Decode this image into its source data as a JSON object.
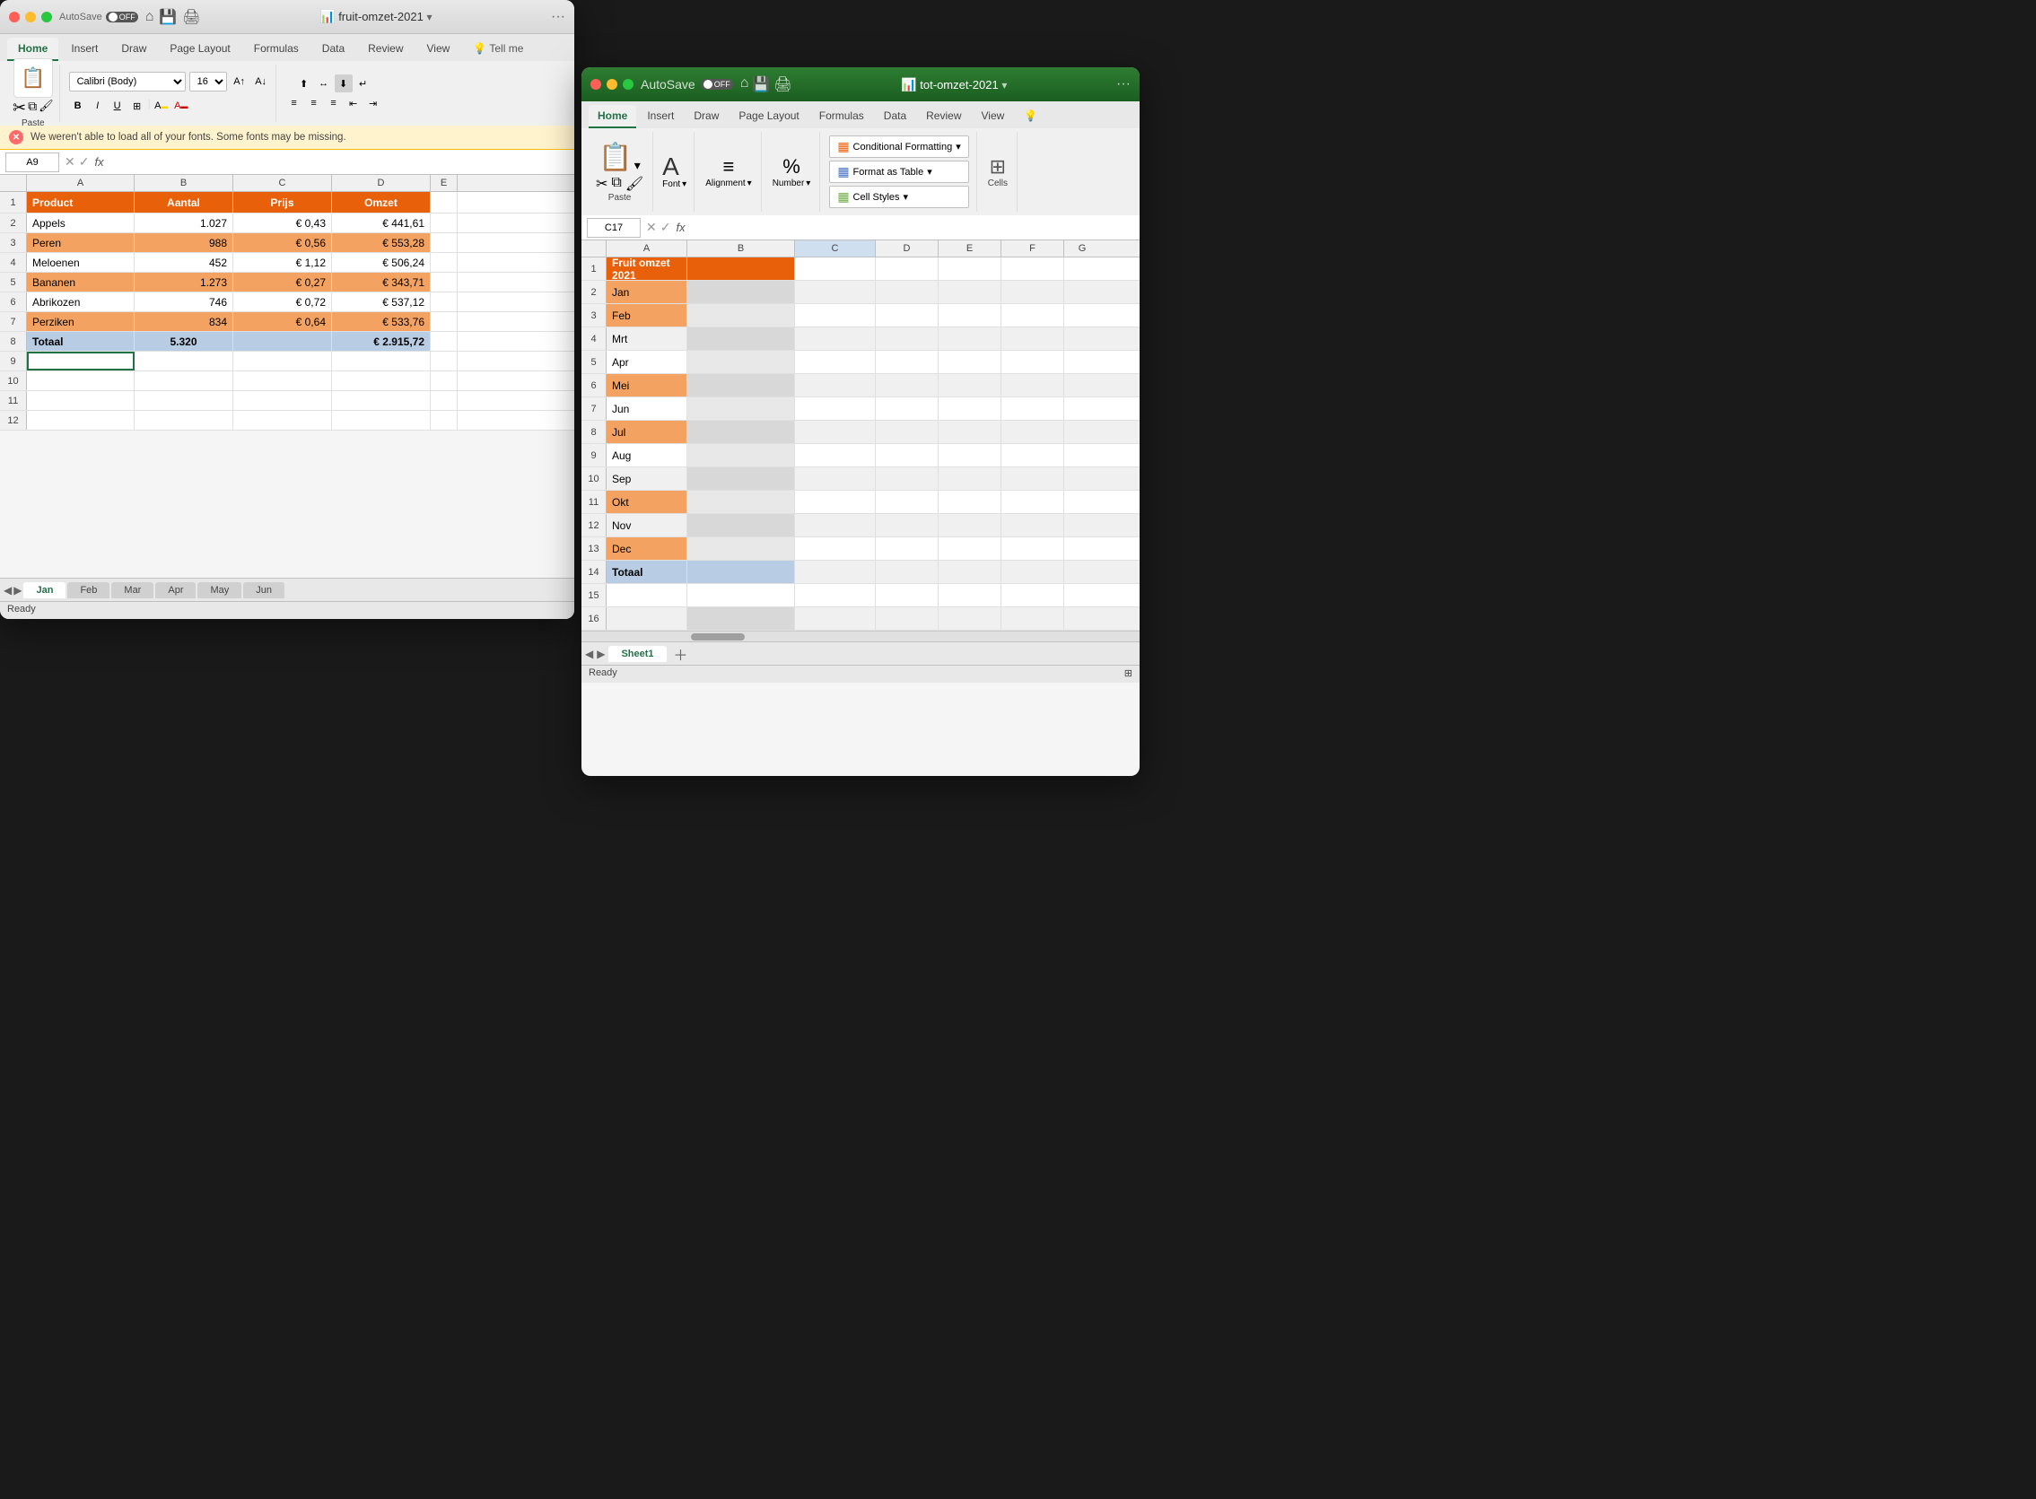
{
  "window1": {
    "title": "fruit-omzet-2021",
    "autosave": "AutoSave",
    "autosave_state": "OFF",
    "tabs": [
      "Home",
      "Insert",
      "Draw",
      "Page Layout",
      "Formulas",
      "Data",
      "Review",
      "View",
      "Tell me"
    ],
    "active_tab": "Home",
    "font_name": "Calibri (Body)",
    "font_size": "16",
    "cell_ref": "A9",
    "formula_text": "",
    "warning_text": "We weren't able to load all of your fonts.  Some fonts may be missing.",
    "columns": [
      {
        "label": "A",
        "width": 120
      },
      {
        "label": "B",
        "width": 110
      },
      {
        "label": "C",
        "width": 110
      },
      {
        "label": "D",
        "width": 110
      },
      {
        "label": "E",
        "width": 30
      }
    ],
    "rows": [
      {
        "num": 1,
        "cells": [
          {
            "text": "Product",
            "bg": "#e8600a",
            "color": "white",
            "bold": true,
            "align": "left"
          },
          {
            "text": "Aantal",
            "bg": "#e8600a",
            "color": "white",
            "bold": true,
            "align": "center"
          },
          {
            "text": "Prijs",
            "bg": "#e8600a",
            "color": "white",
            "bold": true,
            "align": "center"
          },
          {
            "text": "Omzet",
            "bg": "#e8600a",
            "color": "white",
            "bold": true,
            "align": "center"
          },
          {
            "text": "",
            "bg": "",
            "color": "",
            "bold": false,
            "align": "left"
          }
        ]
      },
      {
        "num": 2,
        "cells": [
          {
            "text": "Appels",
            "bg": "",
            "color": "#333",
            "bold": false,
            "align": "left"
          },
          {
            "text": "1.027",
            "bg": "",
            "color": "#333",
            "bold": false,
            "align": "right"
          },
          {
            "text": "€ 0,43",
            "bg": "",
            "color": "#333",
            "bold": false,
            "align": "right"
          },
          {
            "text": "€ 441,61",
            "bg": "",
            "color": "#333",
            "bold": false,
            "align": "right"
          },
          {
            "text": "",
            "bg": "",
            "color": "",
            "bold": false,
            "align": "left"
          }
        ]
      },
      {
        "num": 3,
        "cells": [
          {
            "text": "Peren",
            "bg": "#f4a261",
            "color": "#333",
            "bold": false,
            "align": "left"
          },
          {
            "text": "988",
            "bg": "#f4a261",
            "color": "#333",
            "bold": false,
            "align": "right"
          },
          {
            "text": "€ 0,56",
            "bg": "#f4a261",
            "color": "#333",
            "bold": false,
            "align": "right"
          },
          {
            "text": "€ 553,28",
            "bg": "#f4a261",
            "color": "#333",
            "bold": false,
            "align": "right"
          },
          {
            "text": "",
            "bg": "",
            "color": "",
            "bold": false,
            "align": "left"
          }
        ]
      },
      {
        "num": 4,
        "cells": [
          {
            "text": "Meloenen",
            "bg": "",
            "color": "#333",
            "bold": false,
            "align": "left"
          },
          {
            "text": "452",
            "bg": "",
            "color": "#333",
            "bold": false,
            "align": "right"
          },
          {
            "text": "€ 1,12",
            "bg": "",
            "color": "#333",
            "bold": false,
            "align": "right"
          },
          {
            "text": "€ 506,24",
            "bg": "",
            "color": "#333",
            "bold": false,
            "align": "right"
          },
          {
            "text": "",
            "bg": "",
            "color": "",
            "bold": false,
            "align": "left"
          }
        ]
      },
      {
        "num": 5,
        "cells": [
          {
            "text": "Bananen",
            "bg": "#f4a261",
            "color": "#333",
            "bold": false,
            "align": "left"
          },
          {
            "text": "1.273",
            "bg": "#f4a261",
            "color": "#333",
            "bold": false,
            "align": "right"
          },
          {
            "text": "€ 0,27",
            "bg": "#f4a261",
            "color": "#333",
            "bold": false,
            "align": "right"
          },
          {
            "text": "€ 343,71",
            "bg": "#f4a261",
            "color": "#333",
            "bold": false,
            "align": "right"
          },
          {
            "text": "",
            "bg": "",
            "color": "",
            "bold": false,
            "align": "left"
          }
        ]
      },
      {
        "num": 6,
        "cells": [
          {
            "text": "Abrikozen",
            "bg": "",
            "color": "#333",
            "bold": false,
            "align": "left"
          },
          {
            "text": "746",
            "bg": "",
            "color": "#333",
            "bold": false,
            "align": "right"
          },
          {
            "text": "€ 0,72",
            "bg": "",
            "color": "#333",
            "bold": false,
            "align": "right"
          },
          {
            "text": "€ 537,12",
            "bg": "",
            "color": "#333",
            "bold": false,
            "align": "right"
          },
          {
            "text": "",
            "bg": "",
            "color": "",
            "bold": false,
            "align": "left"
          }
        ]
      },
      {
        "num": 7,
        "cells": [
          {
            "text": "Perziken",
            "bg": "#f4a261",
            "color": "#333",
            "bold": false,
            "align": "left"
          },
          {
            "text": "834",
            "bg": "#f4a261",
            "color": "#333",
            "bold": false,
            "align": "right"
          },
          {
            "text": "€ 0,64",
            "bg": "#f4a261",
            "color": "#333",
            "bold": false,
            "align": "right"
          },
          {
            "text": "€ 533,76",
            "bg": "#f4a261",
            "color": "#333",
            "bold": false,
            "align": "right"
          },
          {
            "text": "",
            "bg": "",
            "color": "",
            "bold": false,
            "align": "left"
          }
        ]
      },
      {
        "num": 8,
        "cells": [
          {
            "text": "Totaal",
            "bg": "#b8cce4",
            "color": "#333",
            "bold": true,
            "align": "left"
          },
          {
            "text": "5.320",
            "bg": "#b8cce4",
            "color": "#333",
            "bold": true,
            "align": "center"
          },
          {
            "text": "",
            "bg": "#b8cce4",
            "color": "#333",
            "bold": false,
            "align": "right"
          },
          {
            "text": "€ 2.915,72",
            "bg": "#b8cce4",
            "color": "#333",
            "bold": true,
            "align": "right"
          },
          {
            "text": "",
            "bg": "",
            "color": "",
            "bold": false,
            "align": "left"
          }
        ]
      },
      {
        "num": 9,
        "cells": [
          {
            "text": "",
            "bg": "",
            "color": "",
            "bold": false,
            "align": "left"
          },
          {
            "text": "",
            "bg": "",
            "color": "",
            "bold": false,
            "align": "left"
          },
          {
            "text": "",
            "bg": "",
            "color": "",
            "bold": false,
            "align": "left"
          },
          {
            "text": "",
            "bg": "",
            "color": "",
            "bold": false,
            "align": "left"
          },
          {
            "text": "",
            "bg": "",
            "color": "",
            "bold": false,
            "align": "left"
          }
        ]
      },
      {
        "num": 10,
        "cells": [
          {
            "text": "",
            "bg": "",
            "color": "",
            "bold": false,
            "align": "left"
          },
          {
            "text": "",
            "bg": "",
            "color": "",
            "bold": false,
            "align": "left"
          },
          {
            "text": "",
            "bg": "",
            "color": "",
            "bold": false,
            "align": "left"
          },
          {
            "text": "",
            "bg": "",
            "color": "",
            "bold": false,
            "align": "left"
          },
          {
            "text": "",
            "bg": "",
            "color": "",
            "bold": false,
            "align": "left"
          }
        ]
      },
      {
        "num": 11,
        "cells": [
          {
            "text": "",
            "bg": "",
            "color": "",
            "bold": false,
            "align": "left"
          },
          {
            "text": "",
            "bg": "",
            "color": "",
            "bold": false,
            "align": "left"
          },
          {
            "text": "",
            "bg": "",
            "color": "",
            "bold": false,
            "align": "left"
          },
          {
            "text": "",
            "bg": "",
            "color": "",
            "bold": false,
            "align": "left"
          },
          {
            "text": "",
            "bg": "",
            "color": "",
            "bold": false,
            "align": "left"
          }
        ]
      },
      {
        "num": 12,
        "cells": [
          {
            "text": "",
            "bg": "",
            "color": "",
            "bold": false,
            "align": "left"
          },
          {
            "text": "",
            "bg": "",
            "color": "",
            "bold": false,
            "align": "left"
          },
          {
            "text": "",
            "bg": "",
            "color": "",
            "bold": false,
            "align": "left"
          },
          {
            "text": "",
            "bg": "",
            "color": "",
            "bold": false,
            "align": "left"
          },
          {
            "text": "",
            "bg": "",
            "color": "",
            "bold": false,
            "align": "left"
          }
        ]
      }
    ],
    "sheet_tabs": [
      "Jan",
      "Feb",
      "Mar",
      "Apr",
      "May",
      "Jun"
    ],
    "active_sheet": "Jan",
    "status": "Ready"
  },
  "window2": {
    "title": "tot-omzet-2021",
    "autosave": "AutoSave",
    "autosave_state": "OFF",
    "tabs": [
      "Home",
      "Insert",
      "Draw",
      "Page Layout",
      "Formulas",
      "Data",
      "Review",
      "View"
    ],
    "active_tab": "Home",
    "cell_ref": "C17",
    "ribbon_groups": {
      "paste_label": "Paste",
      "font_label": "Font",
      "alignment_label": "Alignment",
      "number_label": "Number",
      "conditional_formatting": "Conditional Formatting",
      "format_as_table": "Format as Table",
      "cell_styles": "Cell Styles",
      "cells_label": "Cells"
    },
    "columns": [
      {
        "label": "",
        "width": 28
      },
      {
        "label": "A",
        "width": 90
      },
      {
        "label": "B",
        "width": 120
      },
      {
        "label": "C",
        "width": 90
      },
      {
        "label": "D",
        "width": 70
      },
      {
        "label": "E",
        "width": 70
      },
      {
        "label": "F",
        "width": 70
      },
      {
        "label": "G",
        "width": 40
      }
    ],
    "rows": [
      {
        "num": 1,
        "a": "Fruit omzet 2021",
        "a_bg": "#e8600a",
        "a_color": "white",
        "b_span": true
      },
      {
        "num": 2,
        "a": "Jan",
        "a_bg": "#f4a261"
      },
      {
        "num": 3,
        "a": "Feb",
        "a_bg": "#f4a261"
      },
      {
        "num": 4,
        "a": "Mrt"
      },
      {
        "num": 5,
        "a": "Apr"
      },
      {
        "num": 6,
        "a": "Mei",
        "a_bg": "#f4a261"
      },
      {
        "num": 7,
        "a": "Jun"
      },
      {
        "num": 8,
        "a": "Jul",
        "a_bg": "#f4a261"
      },
      {
        "num": 9,
        "a": "Aug"
      },
      {
        "num": 10,
        "a": "Sep"
      },
      {
        "num": 11,
        "a": "Okt",
        "a_bg": "#f4a261"
      },
      {
        "num": 12,
        "a": "Nov"
      },
      {
        "num": 13,
        "a": "Dec",
        "a_bg": "#f4a261"
      },
      {
        "num": 14,
        "a": "Totaal",
        "a_bold": true,
        "row_bg": "#b8cce4"
      },
      {
        "num": 15
      },
      {
        "num": 16
      }
    ],
    "sheet_tabs": [
      "Sheet1"
    ],
    "active_sheet": "Sheet1",
    "status": "Ready"
  }
}
